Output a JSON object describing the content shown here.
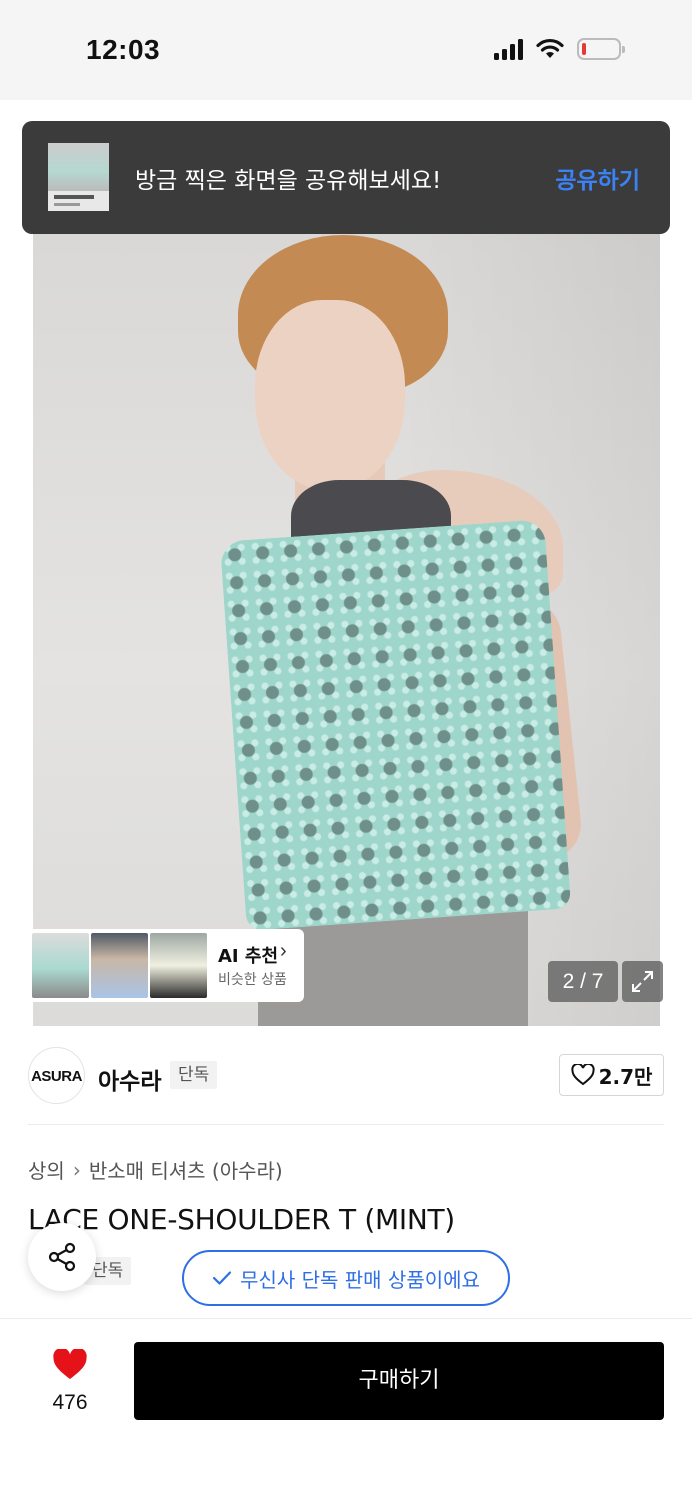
{
  "status_bar": {
    "time": "12:03",
    "icons": [
      "cellular-signal-icon",
      "wifi-icon",
      "battery-low-icon"
    ]
  },
  "share_banner": {
    "text": "방금 찍은 화면을 공유해보세요!",
    "action": "공유하기"
  },
  "gallery": {
    "page_counter": "2 / 7",
    "ai_recommend": {
      "title": "AI 추천",
      "subtitle": "비슷한 상품"
    }
  },
  "brand": {
    "logo_text": "ASURA",
    "name": "아수라",
    "tag": "단독",
    "like_count": "2.7만"
  },
  "product": {
    "breadcrumb": [
      "상의",
      "반소매 티셔츠 (아수라)"
    ],
    "title": "LACE ONE-SHOULDER T (MINT)",
    "tag": "단독",
    "exclusive_notice": "무신사 단독 판매 상품이에요"
  },
  "bottom_bar": {
    "heart_count": "476",
    "buy_label": "구매하기"
  },
  "colors": {
    "accent_blue": "#2f6fe4",
    "banner_action": "#3b82f6",
    "heart_red": "#e5121a",
    "buy_button": "#000000"
  }
}
